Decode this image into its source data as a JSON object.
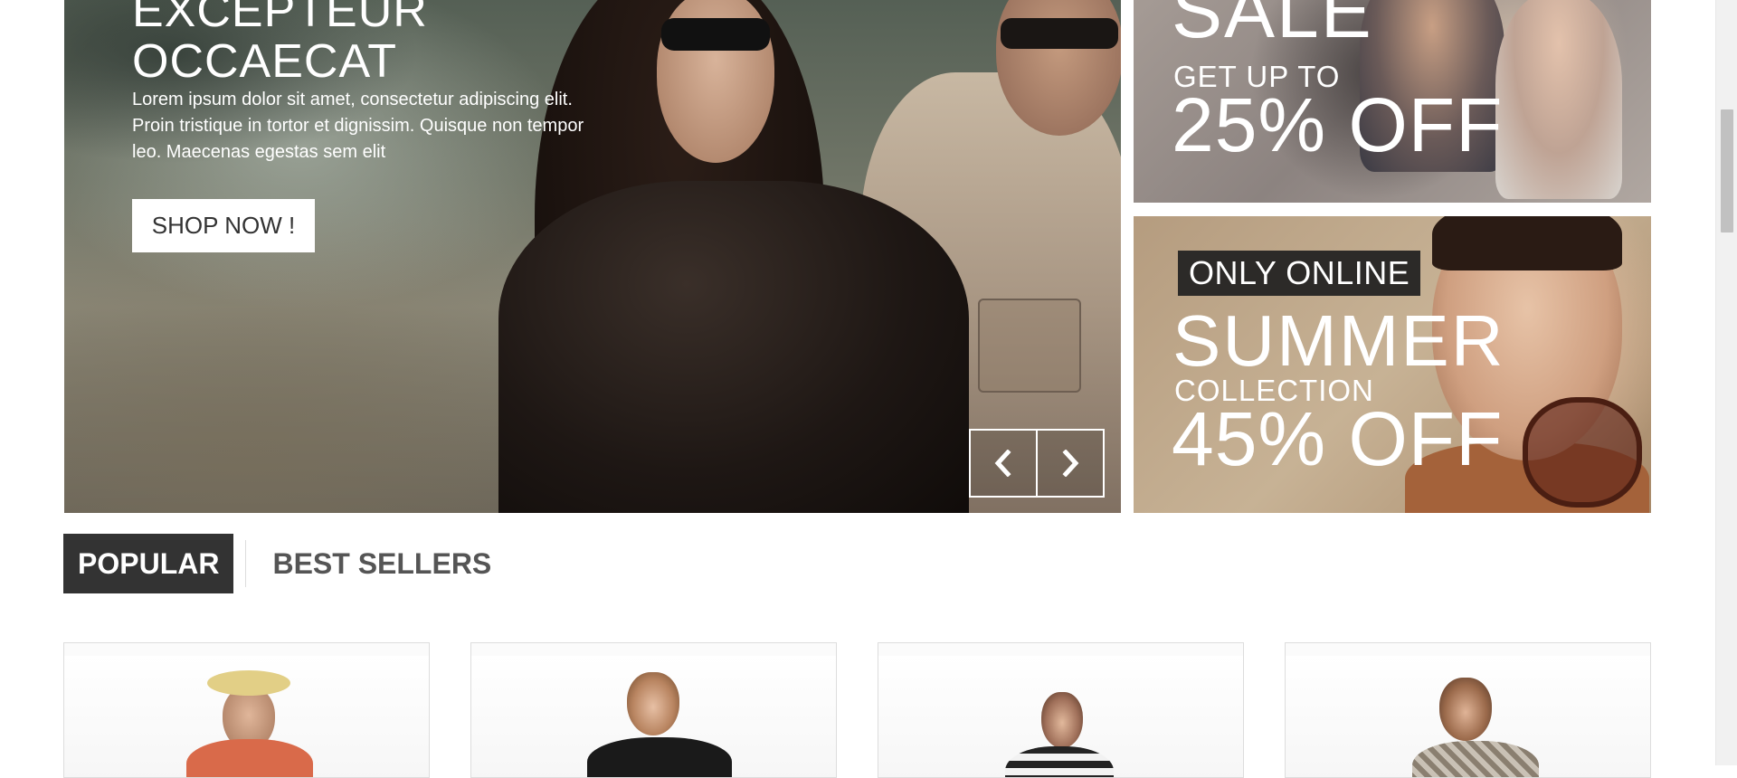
{
  "hero": {
    "title_line1": "EXCEPTEUR",
    "title_line2": "OCCAECAT",
    "text": "Lorem ipsum dolor sit amet, consectetur adipiscing elit. Proin tristique in tortor et dignissim. Quisque non tempor leo. Maecenas egestas sem elit",
    "button_label": "SHOP NOW !",
    "prev_icon": "chevron-left-icon",
    "next_icon": "chevron-right-icon"
  },
  "banner_sale": {
    "big": "SALE",
    "sub": "GET UP TO",
    "percent": "25% OFF"
  },
  "banner_summer": {
    "badge": "ONLY ONLINE",
    "big": "SUMMER",
    "sub": "COLLECTION",
    "percent": "45% OFF"
  },
  "tabs": [
    {
      "label": "POPULAR",
      "active": true
    },
    {
      "label": "BEST SELLERS",
      "active": false
    }
  ],
  "colors": {
    "tab_active_bg": "#333333",
    "tab_inactive_text": "#555555",
    "card_border": "#dddddd"
  }
}
